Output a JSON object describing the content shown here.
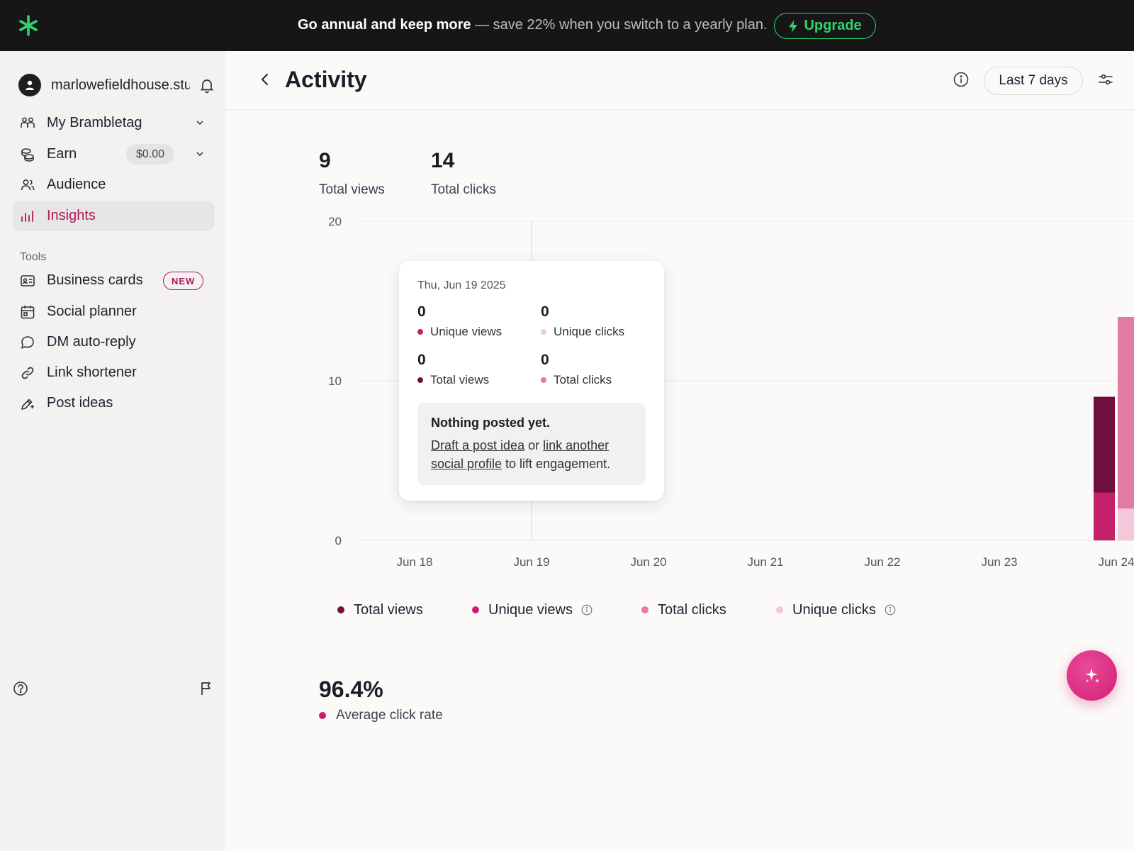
{
  "banner": {
    "headline": "Go annual and keep more",
    "message": " — save 22% when you switch to a yearly plan.",
    "upgrade_label": "Upgrade"
  },
  "sidebar": {
    "account_name": "marlowefieldhouse.studio",
    "items": [
      {
        "label": "My Brambletag",
        "icon": "people-icon"
      },
      {
        "label": "Earn",
        "icon": "coins-icon",
        "badge": "$0.00"
      },
      {
        "label": "Audience",
        "icon": "users-icon"
      },
      {
        "label": "Insights",
        "icon": "bar-chart-icon",
        "active": true
      }
    ],
    "tools_heading": "Tools",
    "tools": [
      {
        "label": "Business cards",
        "icon": "id-card-icon",
        "badge": "NEW"
      },
      {
        "label": "Social planner",
        "icon": "calendar-icon"
      },
      {
        "label": "DM auto-reply",
        "icon": "chat-bubble-icon"
      },
      {
        "label": "Link shortener",
        "icon": "link-icon"
      },
      {
        "label": "Post ideas",
        "icon": "pen-sparkle-icon"
      }
    ]
  },
  "header": {
    "title": "Activity",
    "range_label": "Last 7 days"
  },
  "stats": {
    "total_views": "9",
    "total_views_label": "Total views",
    "total_clicks": "14",
    "total_clicks_label": "Total clicks"
  },
  "colors": {
    "total_views": "#6e0f3e",
    "unique_views": "#c4216b",
    "total_clicks": "#e27aa5",
    "unique_clicks": "#f5c7da",
    "accent": "#b3185d",
    "banner_green": "#2fd46f"
  },
  "chart_data": {
    "type": "bar",
    "stacked": true,
    "categories": [
      "Jun 18",
      "Jun 19",
      "Jun 20",
      "Jun 21",
      "Jun 22",
      "Jun 23",
      "Jun 24"
    ],
    "y_ticks": [
      "0",
      "10",
      "20"
    ],
    "ylim": [
      0,
      20
    ],
    "grid": true,
    "series": [
      {
        "name": "Total views",
        "stack": "views",
        "values": [
          0,
          0,
          0,
          0,
          0,
          0,
          6
        ]
      },
      {
        "name": "Unique views",
        "stack": "views",
        "values": [
          0,
          0,
          0,
          0,
          0,
          0,
          3
        ]
      },
      {
        "name": "Total clicks",
        "stack": "clicks",
        "values": [
          0,
          0,
          0,
          0,
          0,
          0,
          12
        ]
      },
      {
        "name": "Unique clicks",
        "stack": "clicks",
        "values": [
          0,
          0,
          0,
          0,
          0,
          0,
          2
        ]
      }
    ],
    "hover_category": "Jun 19"
  },
  "tooltip": {
    "date": "Thu, Jun 19 2025",
    "unique_views": "0",
    "unique_views_label": "Unique views",
    "unique_clicks": "0",
    "unique_clicks_label": "Unique clicks",
    "total_views": "0",
    "total_views_label": "Total views",
    "total_clicks": "0",
    "total_clicks_label": "Total clicks",
    "note_title": "Nothing posted yet.",
    "note_link1": "Draft a post idea",
    "note_or": " or ",
    "note_link2": "link another social profile",
    "note_tail": " to lift engagement."
  },
  "legend": [
    {
      "label": "Total views"
    },
    {
      "label": "Unique views"
    },
    {
      "label": "Total clicks"
    },
    {
      "label": "Unique clicks"
    }
  ],
  "click_rate": {
    "value": "96.4%",
    "label": "Average click rate"
  }
}
